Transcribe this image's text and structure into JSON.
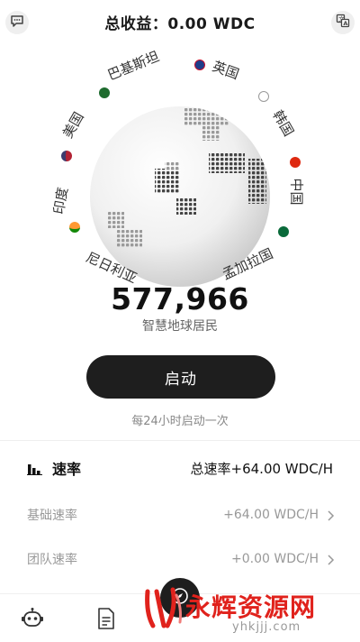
{
  "header": {
    "title": "总收益：0.00 WDC",
    "left_icon": "chat-icon",
    "right_icon": "translate-icon"
  },
  "globe": {
    "countries": [
      {
        "name": "巴基斯坦",
        "flag_color": "#1e6b2e"
      },
      {
        "name": "英国",
        "flag_color": "#1f3d8a"
      },
      {
        "name": "韩国",
        "flag_color": "#ffffff"
      },
      {
        "name": "中国",
        "flag_color": "#de2910"
      },
      {
        "name": "孟加拉国",
        "flag_color": "#0a6a3a"
      },
      {
        "name": "尼日利亚",
        "flag_color": "#0a8a3a"
      },
      {
        "name": "印度",
        "flag_color": "#ff9933"
      },
      {
        "name": "美国",
        "flag_color": "#b22234"
      }
    ]
  },
  "stats": {
    "count": "577,966",
    "count_label": "智慧地球居民"
  },
  "action": {
    "start_label": "启动",
    "note": "每24小时启动一次"
  },
  "rate": {
    "title": "速率",
    "total": "总速率+64.00 WDC/H",
    "rows": [
      {
        "label": "基础速率",
        "value": "+64.00 WDC/H"
      },
      {
        "label": "团队速率",
        "value": "+0.00 WDC/H"
      }
    ]
  },
  "watermark": {
    "main": "永辉资源网",
    "url": "yhkjjj.com"
  },
  "colors": {
    "primary_dark": "#1e1e1e",
    "watermark_red": "#e0221c"
  }
}
